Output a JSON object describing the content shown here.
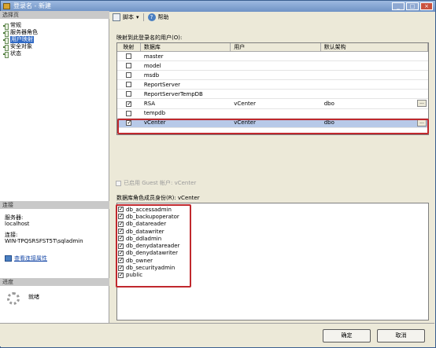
{
  "window": {
    "title": "登录名 - 新建",
    "buttons": [
      "_",
      "□",
      "×"
    ]
  },
  "left": {
    "select_page_title": "选择页",
    "pages": [
      {
        "label": "常规",
        "selected": false
      },
      {
        "label": "服务器角色",
        "selected": false
      },
      {
        "label": "用户映射",
        "selected": true
      },
      {
        "label": "安全对象",
        "selected": false
      },
      {
        "label": "状态",
        "selected": false
      }
    ],
    "connection_title": "连接",
    "server_label": "服务器:",
    "server_value": "localhost",
    "connection_label": "连接:",
    "connection_value": "WIN-TPQSRSFST5T\\sqladmin",
    "view_connection_link": "查看连接属性",
    "progress_title": "进度",
    "progress_status": "就绪"
  },
  "toolbar": {
    "script_label": "脚本",
    "help_label": "帮助"
  },
  "mapping": {
    "title": "映射到此登录名的用户(O):",
    "columns": [
      "映射",
      "数据库",
      "用户",
      "默认架构"
    ],
    "rows": [
      {
        "mapped": false,
        "database": "master",
        "user": "",
        "schema": ""
      },
      {
        "mapped": false,
        "database": "model",
        "user": "",
        "schema": ""
      },
      {
        "mapped": false,
        "database": "msdb",
        "user": "",
        "schema": ""
      },
      {
        "mapped": false,
        "database": "ReportServer",
        "user": "",
        "schema": ""
      },
      {
        "mapped": false,
        "database": "ReportServerTempDB",
        "user": "",
        "schema": ""
      },
      {
        "mapped": true,
        "database": "RSA",
        "user": "vCenter",
        "schema": "dbo"
      },
      {
        "mapped": false,
        "database": "tempdb",
        "user": "",
        "schema": ""
      },
      {
        "mapped": true,
        "database": "vCenter",
        "user": "vCenter",
        "schema": "dbo"
      }
    ]
  },
  "guest": {
    "label": "已启用 Guest 帐户: vCenter"
  },
  "roles": {
    "title": "数据库角色成员身份(R): vCenter",
    "items": [
      "db_accessadmin",
      "db_backupoperator",
      "db_datareader",
      "db_datawriter",
      "db_ddladmin",
      "db_denydatareader",
      "db_denydatawriter",
      "db_owner",
      "db_securityadmin",
      "public"
    ]
  },
  "buttons": {
    "ok": "确定",
    "cancel": "取消"
  }
}
